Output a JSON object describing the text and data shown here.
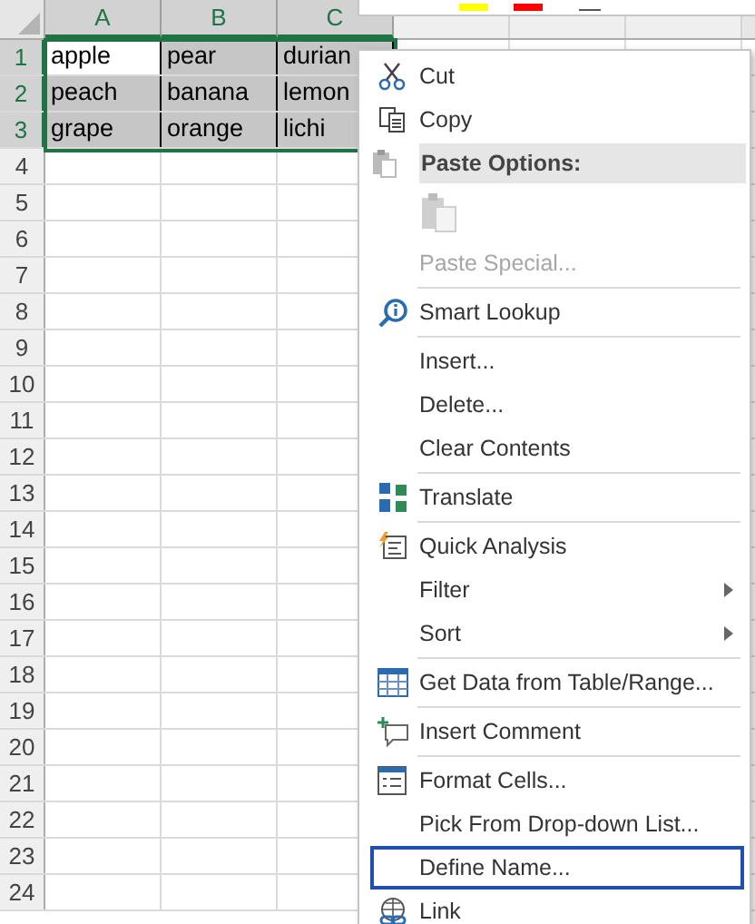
{
  "columns": [
    {
      "label": "A",
      "selected": true
    },
    {
      "label": "B",
      "selected": true
    },
    {
      "label": "C",
      "selected": true
    },
    {
      "selected": false
    },
    {
      "selected": false
    },
    {
      "selected": false
    }
  ],
  "rows": [
    {
      "number": "1",
      "selected": true,
      "cells": [
        "apple",
        "pear",
        "durian"
      ]
    },
    {
      "number": "2",
      "selected": true,
      "cells": [
        "peach",
        "banana",
        "lemon"
      ]
    },
    {
      "number": "3",
      "selected": true,
      "cells": [
        "grape",
        "orange",
        "lichi"
      ]
    },
    {
      "number": "4",
      "selected": false,
      "cells": []
    },
    {
      "number": "5",
      "selected": false,
      "cells": []
    },
    {
      "number": "6",
      "selected": false,
      "cells": []
    },
    {
      "number": "7",
      "selected": false,
      "cells": []
    },
    {
      "number": "8",
      "selected": false,
      "cells": []
    },
    {
      "number": "9",
      "selected": false,
      "cells": []
    },
    {
      "number": "10",
      "selected": false,
      "cells": []
    },
    {
      "number": "11",
      "selected": false,
      "cells": []
    },
    {
      "number": "12",
      "selected": false,
      "cells": []
    },
    {
      "number": "13",
      "selected": false,
      "cells": []
    },
    {
      "number": "14",
      "selected": false,
      "cells": []
    },
    {
      "number": "15",
      "selected": false,
      "cells": []
    },
    {
      "number": "16",
      "selected": false,
      "cells": []
    },
    {
      "number": "17",
      "selected": false,
      "cells": []
    },
    {
      "number": "18",
      "selected": false,
      "cells": []
    },
    {
      "number": "19",
      "selected": false,
      "cells": []
    },
    {
      "number": "20",
      "selected": false,
      "cells": []
    },
    {
      "number": "21",
      "selected": false,
      "cells": []
    },
    {
      "number": "22",
      "selected": false,
      "cells": []
    },
    {
      "number": "23",
      "selected": false,
      "cells": []
    },
    {
      "number": "24",
      "selected": false,
      "cells": []
    }
  ],
  "context_menu": [
    {
      "kind": "item",
      "label": "Cut",
      "disabled": false,
      "submenu": false,
      "highlighted": false
    },
    {
      "kind": "item",
      "label": "Copy",
      "disabled": false,
      "submenu": false,
      "highlighted": false
    },
    {
      "kind": "header",
      "label": "Paste Options:"
    },
    {
      "kind": "paste_icons"
    },
    {
      "kind": "item",
      "label": "Paste Special...",
      "disabled": true,
      "submenu": false,
      "highlighted": false
    },
    {
      "kind": "separator"
    },
    {
      "kind": "item",
      "label": "Smart Lookup",
      "disabled": false,
      "submenu": false,
      "highlighted": false
    },
    {
      "kind": "separator"
    },
    {
      "kind": "item",
      "label": "Insert...",
      "disabled": false,
      "submenu": false,
      "highlighted": false
    },
    {
      "kind": "item",
      "label": "Delete...",
      "disabled": false,
      "submenu": false,
      "highlighted": false
    },
    {
      "kind": "item",
      "label": "Clear Contents",
      "disabled": false,
      "submenu": false,
      "highlighted": false
    },
    {
      "kind": "separator"
    },
    {
      "kind": "item",
      "label": "Translate",
      "disabled": false,
      "submenu": false,
      "highlighted": false
    },
    {
      "kind": "separator"
    },
    {
      "kind": "item",
      "label": "Quick Analysis",
      "disabled": false,
      "submenu": false,
      "highlighted": false
    },
    {
      "kind": "item",
      "label": "Filter",
      "disabled": false,
      "submenu": true,
      "highlighted": false
    },
    {
      "kind": "item",
      "label": "Sort",
      "disabled": false,
      "submenu": true,
      "highlighted": false
    },
    {
      "kind": "separator"
    },
    {
      "kind": "item",
      "label": "Get Data from Table/Range...",
      "disabled": false,
      "submenu": false,
      "highlighted": false
    },
    {
      "kind": "separator"
    },
    {
      "kind": "item",
      "label": "Insert Comment",
      "disabled": false,
      "submenu": false,
      "highlighted": false
    },
    {
      "kind": "separator"
    },
    {
      "kind": "item",
      "label": "Format Cells...",
      "disabled": false,
      "submenu": false,
      "highlighted": false
    },
    {
      "kind": "item",
      "label": "Pick From Drop-down List...",
      "disabled": false,
      "submenu": false,
      "highlighted": false
    },
    {
      "kind": "item",
      "label": "Define Name...",
      "disabled": false,
      "submenu": false,
      "highlighted": true
    },
    {
      "kind": "item",
      "label": "Link",
      "disabled": false,
      "submenu": false,
      "highlighted": false
    }
  ]
}
